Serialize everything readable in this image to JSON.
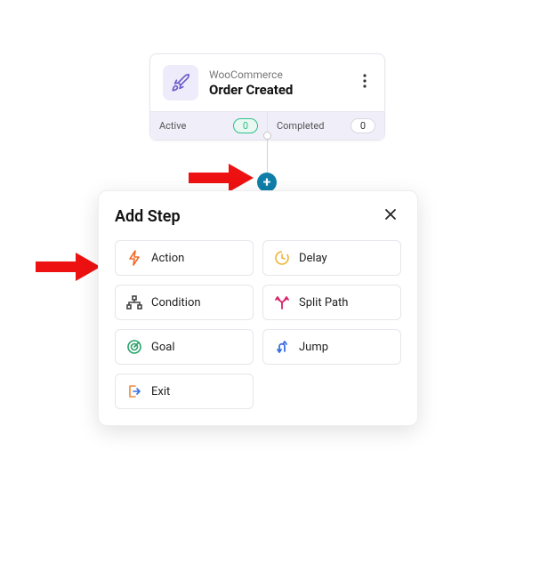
{
  "trigger": {
    "subtitle": "WooCommerce",
    "title": "Order Created",
    "stats": {
      "active_label": "Active",
      "active_count": "0",
      "completed_label": "Completed",
      "completed_count": "0"
    }
  },
  "modal": {
    "title": "Add Step",
    "steps": {
      "action": "Action",
      "delay": "Delay",
      "condition": "Condition",
      "split_path": "Split Path",
      "goal": "Goal",
      "jump": "Jump",
      "exit": "Exit"
    }
  }
}
